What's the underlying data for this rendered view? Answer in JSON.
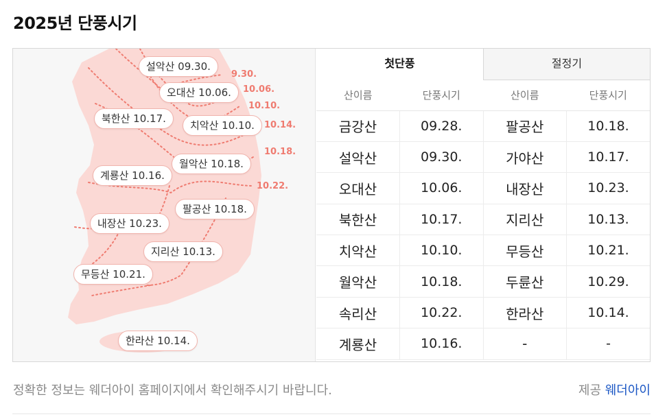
{
  "title": "2025년 단풍시기",
  "map": {
    "mountain_labels": [
      "설악산 09.30.",
      "오대산 10.06.",
      "북한산 10.17.",
      "치악산 10.10.",
      "월악산 10.18.",
      "계룡산 10.16.",
      "팔공산 10.18.",
      "내장산 10.23.",
      "지리산 10.13.",
      "무등산 10.21.",
      "한라산 10.14."
    ],
    "date_lines": [
      "9.30.",
      "10.06.",
      "10.10.",
      "10.14.",
      "10.18.",
      "10.22."
    ],
    "colors": {
      "land": "#fbd9d5",
      "line": "#ef7b70",
      "accent_text": "#ef7b70"
    }
  },
  "tabs": [
    "첫단풍",
    "절정기"
  ],
  "active_tab": "첫단풍",
  "table": {
    "headers": [
      "산이름",
      "단풍시기",
      "산이름",
      "단풍시기"
    ],
    "rows": [
      [
        "금강산",
        "09.28.",
        "팔공산",
        "10.18."
      ],
      [
        "설악산",
        "09.30.",
        "가야산",
        "10.17."
      ],
      [
        "오대산",
        "10.06.",
        "내장산",
        "10.23."
      ],
      [
        "북한산",
        "10.17.",
        "지리산",
        "10.13."
      ],
      [
        "치악산",
        "10.10.",
        "무등산",
        "10.21."
      ],
      [
        "월악산",
        "10.18.",
        "두륜산",
        "10.29."
      ],
      [
        "속리산",
        "10.22.",
        "한라산",
        "10.14."
      ],
      [
        "계룡산",
        "10.16.",
        "-",
        "-"
      ]
    ]
  },
  "footer": {
    "note": "정확한 정보는 웨더아이 홈페이지에서 확인해주시기 바랍니다.",
    "source_prefix": "제공",
    "source_link": "웨더아이"
  }
}
